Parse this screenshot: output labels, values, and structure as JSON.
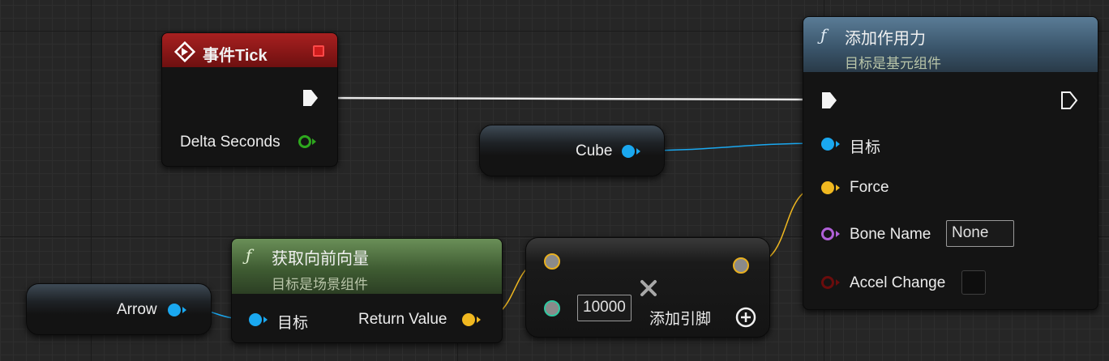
{
  "event_tick": {
    "title": "事件Tick",
    "delta_label": "Delta Seconds"
  },
  "add_force": {
    "title": "添加作用力",
    "subtitle": "目标是基元组件",
    "target_label": "目标",
    "force_label": "Force",
    "bone_label": "Bone Name",
    "bone_value": "None",
    "accel_label": "Accel Change"
  },
  "cube_var": {
    "label": "Cube"
  },
  "arrow_var": {
    "label": "Arrow"
  },
  "forward_vec": {
    "title": "获取向前向量",
    "subtitle": "目标是场景组件",
    "target_label": "目标",
    "return_label": "Return Value"
  },
  "multiply": {
    "value": "10000",
    "add_pin_label": "添加引脚"
  },
  "colors": {
    "event_header": "#8b1a1a",
    "function_header": "#3d5f7a",
    "pure_header": "#4f7040",
    "exec_wire": "#e8e8e8",
    "object_wire": "#1aa8f0",
    "vector_wire": "#f0b820"
  }
}
